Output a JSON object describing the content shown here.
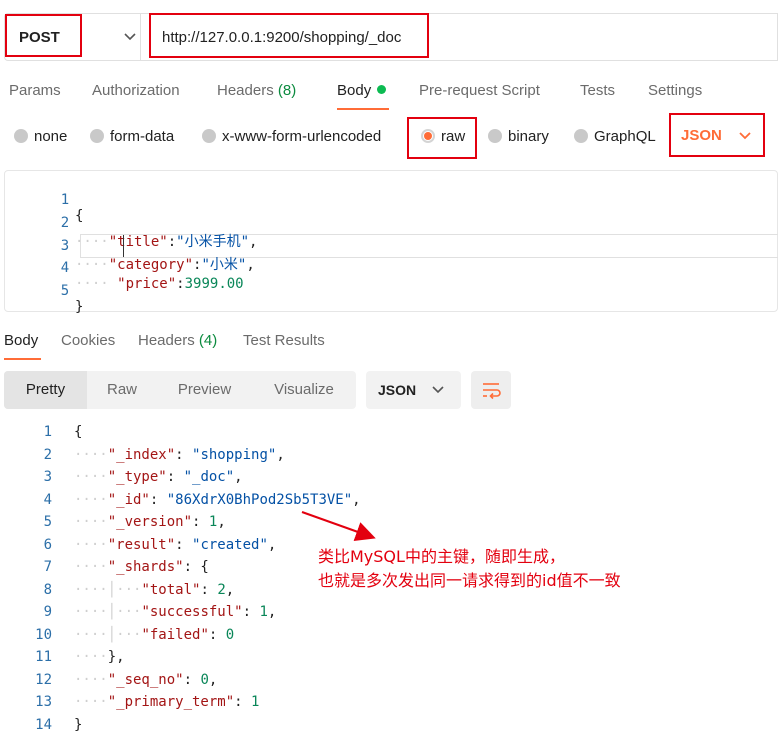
{
  "request": {
    "method": "POST",
    "url": "http://127.0.0.1:9200/shopping/_doc"
  },
  "request_tabs": [
    {
      "label": "Params"
    },
    {
      "label": "Authorization"
    },
    {
      "label": "Headers",
      "count": "(8)"
    },
    {
      "label": "Body"
    },
    {
      "label": "Pre-request Script"
    },
    {
      "label": "Tests"
    },
    {
      "label": "Settings"
    }
  ],
  "body_types": [
    {
      "label": "none"
    },
    {
      "label": "form-data"
    },
    {
      "label": "x-www-form-urlencoded"
    },
    {
      "label": "raw",
      "selected": true
    },
    {
      "label": "binary"
    },
    {
      "label": "GraphQL"
    }
  ],
  "body_language": "JSON",
  "request_body": {
    "line_numbers": [
      "1",
      "2",
      "3",
      "4",
      "5"
    ],
    "open_brace": "{",
    "title_key": "\"title\"",
    "title_value": "\"小米手机\"",
    "category_key": "\"category\"",
    "category_value": "\"小米\"",
    "price_key": "\"price\"",
    "price_value": "3999.00",
    "close_brace": "}"
  },
  "response_tabs": [
    {
      "label": "Body"
    },
    {
      "label": "Cookies"
    },
    {
      "label": "Headers",
      "count": "(4)"
    },
    {
      "label": "Test Results"
    }
  ],
  "view_modes": [
    "Pretty",
    "Raw",
    "Preview",
    "Visualize"
  ],
  "response_language": "JSON",
  "response_body": {
    "line_numbers": [
      "1",
      "2",
      "3",
      "4",
      "5",
      "6",
      "7",
      "8",
      "9",
      "10",
      "11",
      "12",
      "13",
      "14"
    ],
    "index_key": "\"_index\"",
    "index_value": "\"shopping\"",
    "type_key": "\"_type\"",
    "type_value": "\"_doc\"",
    "id_key": "\"_id\"",
    "id_value": "\"86XdrX0BhPod2Sb5T3VE\"",
    "version_key": "\"_version\"",
    "version_value": "1",
    "result_key": "\"result\"",
    "result_value": "\"created\"",
    "shards_key": "\"_shards\"",
    "total_key": "\"total\"",
    "total_value": "2",
    "successful_key": "\"successful\"",
    "successful_value": "1",
    "failed_key": "\"failed\"",
    "failed_value": "0",
    "seq_no_key": "\"_seq_no\"",
    "seq_no_value": "0",
    "primary_term_key": "\"_primary_term\"",
    "primary_term_value": "1"
  },
  "annotation": {
    "line1": "类比MySQL中的主键，随即生成，",
    "line2": "也就是多次发出同一请求得到的id值不一致",
    "color": "#e3000f"
  },
  "colors": {
    "accent": "#ff6c37",
    "highlight_box": "#e3000f",
    "count_green": "#0b8a3e"
  }
}
